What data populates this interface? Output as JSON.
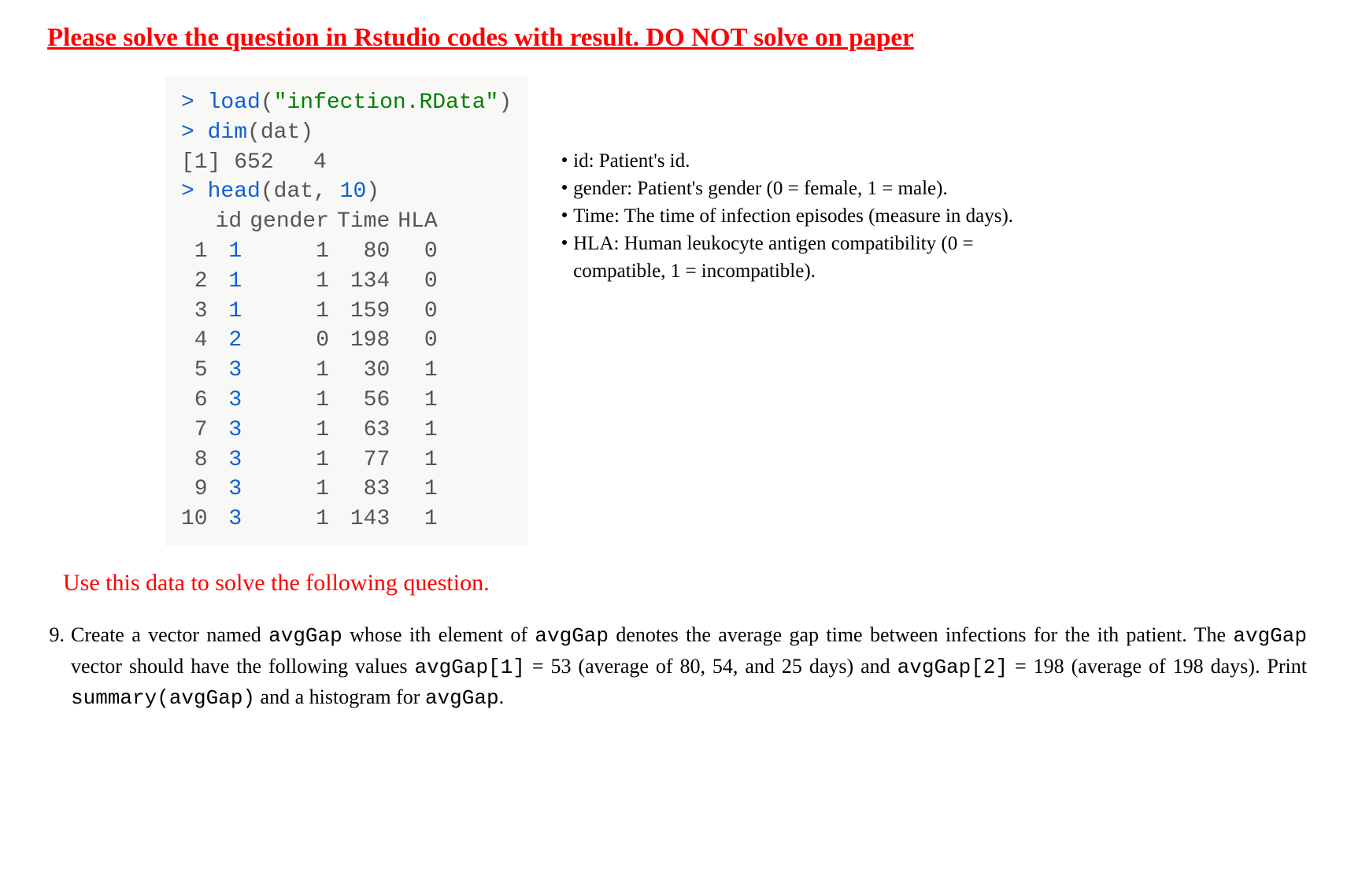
{
  "title": "Please solve the question in Rstudio codes with result. DO NOT solve on paper",
  "code": {
    "prompt1": ">",
    "fn_load": "load",
    "paren_open": "(",
    "str_load": "\"infection.RData\"",
    "paren_close": ")",
    "prompt2": ">",
    "fn_dim": "dim",
    "arg_dim": "(dat)",
    "dim_out": "[1] 652   4",
    "prompt3": ">",
    "fn_head": "head",
    "arg_head_open": "(dat, ",
    "num_head": "10",
    "arg_head_close": ")"
  },
  "head_table": {
    "headers": [
      "",
      "id",
      "gender",
      "Time",
      "HLA"
    ],
    "rows": [
      {
        "idx": "1",
        "id": "1",
        "gender": "1",
        "time": "80",
        "hla": "0"
      },
      {
        "idx": "2",
        "id": "1",
        "gender": "1",
        "time": "134",
        "hla": "0"
      },
      {
        "idx": "3",
        "id": "1",
        "gender": "1",
        "time": "159",
        "hla": "0"
      },
      {
        "idx": "4",
        "id": "2",
        "gender": "0",
        "time": "198",
        "hla": "0"
      },
      {
        "idx": "5",
        "id": "3",
        "gender": "1",
        "time": "30",
        "hla": "1"
      },
      {
        "idx": "6",
        "id": "3",
        "gender": "1",
        "time": "56",
        "hla": "1"
      },
      {
        "idx": "7",
        "id": "3",
        "gender": "1",
        "time": "63",
        "hla": "1"
      },
      {
        "idx": "8",
        "id": "3",
        "gender": "1",
        "time": "77",
        "hla": "1"
      },
      {
        "idx": "9",
        "id": "3",
        "gender": "1",
        "time": "83",
        "hla": "1"
      },
      {
        "idx": "10",
        "id": "3",
        "gender": "1",
        "time": "143",
        "hla": "1"
      }
    ]
  },
  "desc": {
    "li1": "id: Patient's id.",
    "li2": "gender: Patient's gender (0 = female, 1 = male).",
    "li3": "Time: The time of infection episodes (measure in days).",
    "li4a": "HLA: Human leukocyte antigen compatibility (0 = ",
    "li4b": "compatible, 1 = incompatible)."
  },
  "subhead": "Use this data to solve the following question.",
  "question": {
    "number": "9.",
    "segments": {
      "s1": "Create a vector named ",
      "c1": "avgGap",
      "s2": " whose ith element of ",
      "c2": "avgGap",
      "s3": " denotes the average gap time between infections for the ith patient.  The ",
      "c3": "avgGap",
      "s4": " vector should have the following values ",
      "c4": "avgGap[1]",
      "s5": " = 53 (average of 80, 54, and 25 days) and ",
      "c5": "avgGap[2]",
      "s6": " = 198 (average of 198 days).  Print ",
      "c6": "summary(avgGap)",
      "s7": " and a histogram for ",
      "c7": "avgGap",
      "s8": "."
    }
  }
}
